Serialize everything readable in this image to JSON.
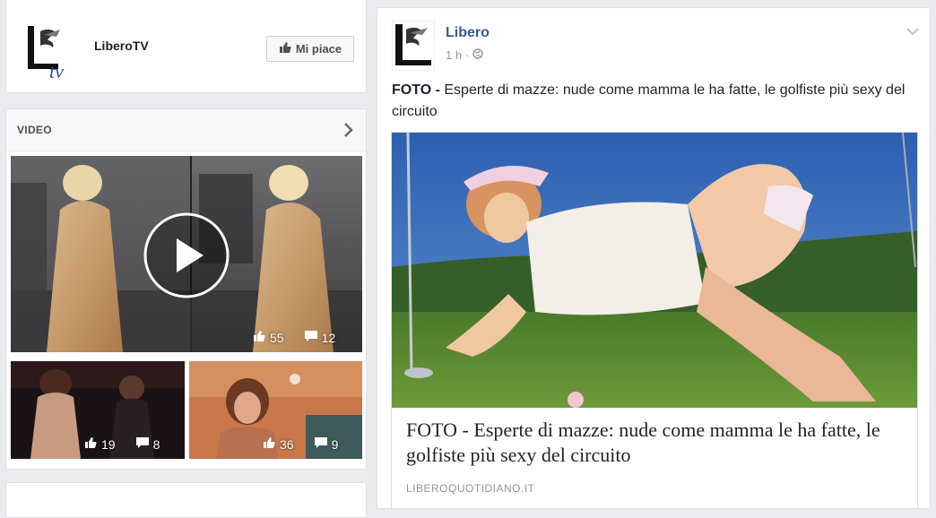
{
  "page_card": {
    "name": "LiberoTV",
    "like_label": "Mi piace"
  },
  "video_card": {
    "title": "VIDEO",
    "videos": [
      {
        "likes": "55",
        "comments": "12"
      },
      {
        "likes": "19",
        "comments": "8"
      },
      {
        "likes": "36",
        "comments": "9"
      }
    ]
  },
  "post": {
    "author": "Libero",
    "time": "1 h",
    "separator": "·",
    "prefix": "FOTO -",
    "text": " Esperte di mazze: nude come mamma le ha fatte, le golfiste più sexy del circuito",
    "link_title": "FOTO - Esperte di mazze: nude come mamma le ha fatte, le golfiste più sexy del circuito",
    "link_domain": "LIBEROQUOTIDIANO.IT"
  },
  "colors": {
    "background": "#e9ebee",
    "link_blue": "#365899",
    "meta_gray": "#90949c"
  },
  "icons": [
    "libero-tv-logo",
    "thumbs-up-icon",
    "chevron-right-icon",
    "play-icon",
    "comment-icon",
    "libero-logo",
    "globe-icon",
    "chevron-down-icon"
  ]
}
